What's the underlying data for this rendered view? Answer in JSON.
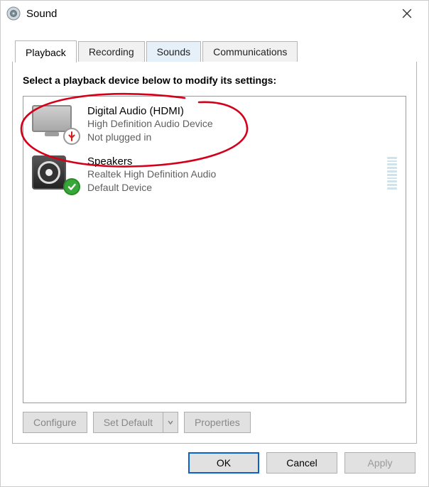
{
  "window": {
    "title": "Sound"
  },
  "tabs": [
    {
      "label": "Playback",
      "active": true
    },
    {
      "label": "Recording",
      "active": false
    },
    {
      "label": "Sounds",
      "active": false,
      "highlight": true
    },
    {
      "label": "Communications",
      "active": false
    }
  ],
  "instructions": "Select a playback device below to modify its settings:",
  "devices": [
    {
      "name": "Digital Audio (HDMI)",
      "description": "High Definition Audio Device",
      "status": "Not plugged in",
      "badge": "unplugged",
      "icon": "monitor"
    },
    {
      "name": "Speakers",
      "description": "Realtek High Definition Audio",
      "status": "Default Device",
      "badge": "ok",
      "icon": "speaker"
    }
  ],
  "panel_buttons": {
    "configure": "Configure",
    "set_default": "Set Default",
    "properties": "Properties"
  },
  "dialog_buttons": {
    "ok": "OK",
    "cancel": "Cancel",
    "apply": "Apply"
  }
}
